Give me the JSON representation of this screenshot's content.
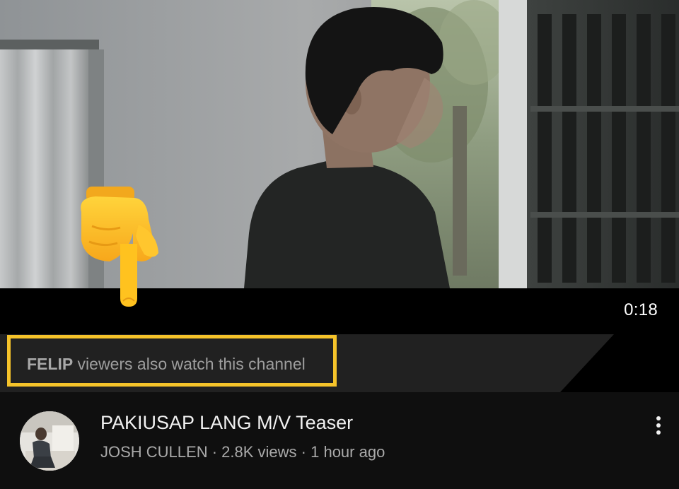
{
  "video": {
    "duration": "0:18"
  },
  "banner": {
    "channel_name": "FELIP",
    "suffix": " viewers also watch this channel"
  },
  "recommendation": {
    "title": "PAKIUSAP LANG M/V Teaser",
    "channel": "JOSH CULLEN",
    "separator": " · ",
    "views": "2.8K views",
    "age": "1 hour ago"
  },
  "icons": {
    "pointer": "backhand-index-pointing-down-icon",
    "more": "vertical-ellipsis-icon"
  },
  "colors": {
    "highlight": "#f5c32a",
    "background": "#0f0f0f",
    "banner_text": "#9e9e9e"
  }
}
